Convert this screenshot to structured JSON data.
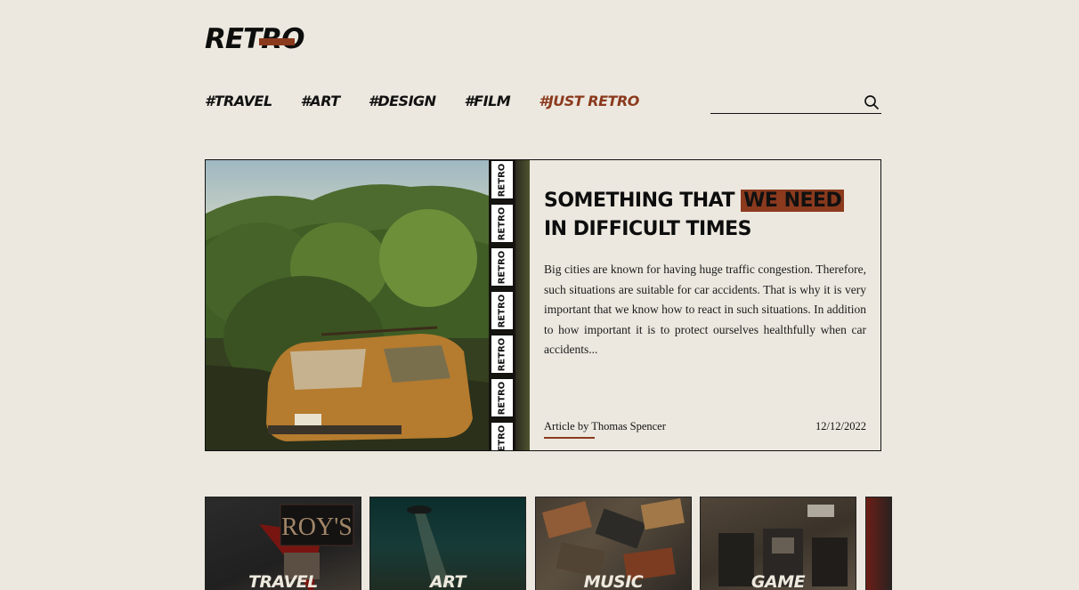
{
  "brand": {
    "logo": "RETRO",
    "accent": "#8b3a1e",
    "background": "#ece8df"
  },
  "nav": {
    "items": [
      {
        "label": "#TRAVEL"
      },
      {
        "label": "#ART"
      },
      {
        "label": "#DESIGN"
      },
      {
        "label": "#FILM"
      },
      {
        "label": "#JUST RETRO",
        "active": true
      }
    ]
  },
  "search": {
    "placeholder": "",
    "icon": "search-icon"
  },
  "featured": {
    "title_before": "SOMETHING THAT ",
    "title_highlight": "WE NEED",
    "title_after": " IN DIFFICULT TIMES",
    "excerpt": "Big cities are known for having huge traffic congestion. Therefore, such situations are suitable for car accidents. That is why it is very important that we know how to react in such situations. In addition to how important it is to protect ourselves healthfully when car accidents...",
    "byline": "Article by Thomas Spencer",
    "date": "12/12/2022",
    "film_label": "RETRO"
  },
  "categories": [
    {
      "label": "TRAVEL"
    },
    {
      "label": "ART"
    },
    {
      "label": "MUSIC"
    },
    {
      "label": "GAME"
    }
  ]
}
